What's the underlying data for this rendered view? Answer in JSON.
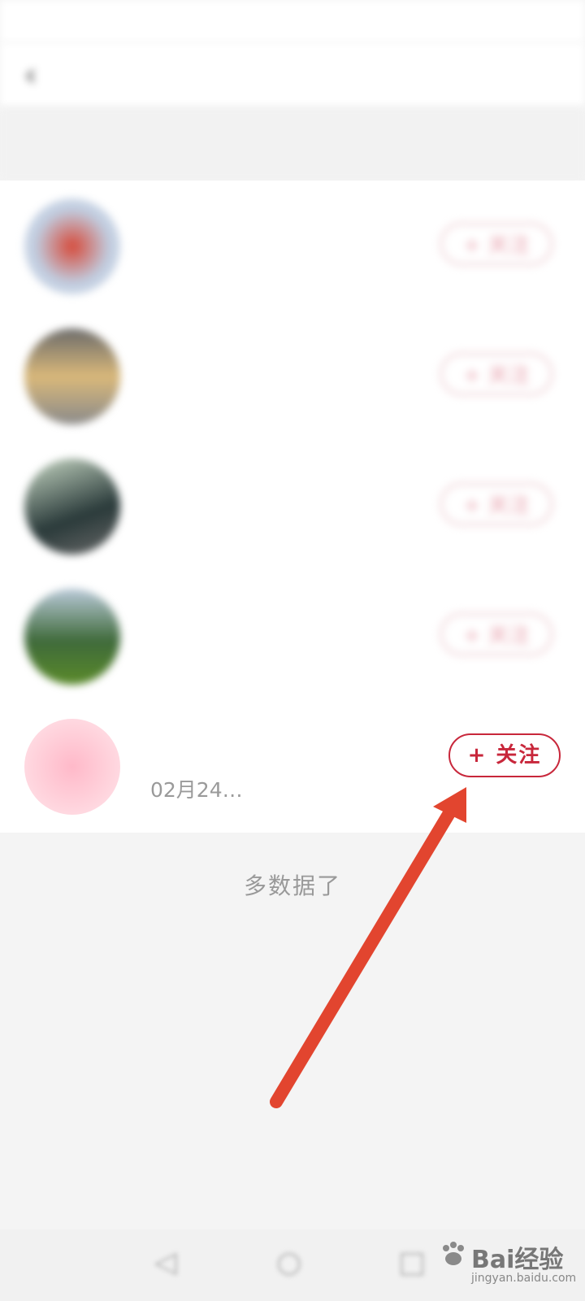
{
  "status_bar": {
    "left": "",
    "right": ""
  },
  "nav": {
    "title": "",
    "action": ""
  },
  "subheader": {
    "text": ""
  },
  "contacts": [
    {
      "name": "",
      "subtitle": "",
      "follow_label": "+ 关注"
    },
    {
      "name": "",
      "subtitle": "",
      "follow_label": "+ 关注"
    },
    {
      "name": "",
      "subtitle": "",
      "follow_label": "+ 关注"
    },
    {
      "name": "",
      "subtitle": "",
      "follow_label": "+ 关注"
    },
    {
      "name": "",
      "subtitle_visible": "02月24…",
      "follow_label": "+ 关注"
    }
  ],
  "footer": {
    "visible_text": "多数据了"
  },
  "watermark": {
    "brand": "Bai经验",
    "url": "jingyan.baidu.com"
  },
  "colors": {
    "accent": "#c8273b",
    "arrow": "#e2452f",
    "background": "#f4f4f4"
  }
}
